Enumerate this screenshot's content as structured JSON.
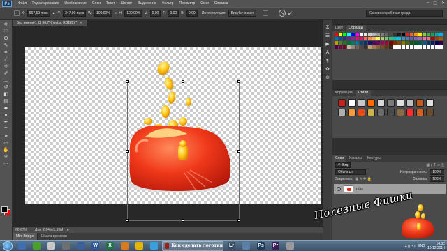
{
  "app": {
    "logo": "Ps"
  },
  "menu": [
    "Файл",
    "Редактирование",
    "Изображение",
    "Слои",
    "Текст",
    "Шрифт",
    "Выделение",
    "Фильтр",
    "Просмотр",
    "Окно",
    "Справка"
  ],
  "options": {
    "x_label": "X:",
    "x_value": "667,50 пикс",
    "y_label": "Y:",
    "y_value": "347,00 пикс",
    "w_label": "W:",
    "w_value": "100,00%",
    "h_label": "H:",
    "h_value": "100,00%",
    "angle_value": "0,00",
    "hskew_label": "Г:",
    "hskew_value": "0,00",
    "vskew_label": "В:",
    "vskew_value": "0,00",
    "interp_label": "Интерполяция:",
    "interp_value": "Бикубическая",
    "workspace": "Основная рабочая среда"
  },
  "document": {
    "tab_title": "Без имени-1 @ 66,7% (rebs, RGB/8) *",
    "zoom": "66,67%",
    "doc_info": "Док: 2,64М/1,99М"
  },
  "bottom_tabs": [
    "Mini Bridge",
    "Шкала времени"
  ],
  "panels": {
    "swatches_tabs": [
      "Цвет",
      "Образцы"
    ],
    "styles_tabs": [
      "Коррекция",
      "Стили"
    ],
    "layers_tabs": [
      "Слои",
      "Каналы",
      "Контуры"
    ],
    "kind_label": "Вид",
    "blend_mode": "Обычные",
    "opacity_label": "Непрозрачность:",
    "opacity_value": "100%",
    "lock_label": "Закрепить:",
    "fill_label": "Заливка:",
    "fill_value": "100%",
    "layer_name": "rebs"
  },
  "swatch_colors": [
    "#ff0000",
    "#ffff00",
    "#00ff00",
    "#00ffff",
    "#0000ff",
    "#ff00ff",
    "#ffffff",
    "#e6e6e6",
    "#cccccc",
    "#b3b3b3",
    "#999999",
    "#808080",
    "#666666",
    "#4d4d4d",
    "#333333",
    "#1a1a1a",
    "#000000",
    "#ed1c24",
    "#f26522",
    "#f7941d",
    "#fff200",
    "#8dc63f",
    "#39b54a",
    "#00a651",
    "#00a99d",
    "#00aeef",
    "#0072bc",
    "#0054a6",
    "#2e3192",
    "#662d91",
    "#92278f",
    "#ec008c",
    "#ed145b",
    "#f26c4f",
    "#f68e56",
    "#fbaf5d",
    "#fff568",
    "#acd373",
    "#7cc576",
    "#3cb878",
    "#1cbbb4",
    "#00bff3",
    "#448ccb",
    "#5674b9",
    "#605ca8",
    "#8560a8",
    "#a864a8",
    "#f06eaa",
    "#f26d7d",
    "#9e0b0f",
    "#a0410d",
    "#a36209",
    "#aba000",
    "#598527",
    "#1a7b30",
    "#007236",
    "#00746b",
    "#0076a3",
    "#004b80",
    "#003471",
    "#1b1464",
    "#440e62",
    "#630460",
    "#9e005d",
    "#9e0039",
    "#790000",
    "#7b2e00",
    "#7d4900",
    "#827b00",
    "#406618",
    "#005e20",
    "#005826",
    "#005952",
    "#005b7f",
    "#003663",
    "#002157",
    "#0d004c",
    "#32004b",
    "#4b0049",
    "#7b0046",
    "#7a0026",
    "#c7b299",
    "#998675",
    "#736357",
    "#534741",
    "#37302d",
    "#c69c6d",
    "#a67c52",
    "#8c6239",
    "#754c24",
    "#603913",
    "#3c2415",
    "#ffffff",
    "#ffffff",
    "#ffffff",
    "#ffffff",
    "#ffffff",
    "#ffffff",
    "#ffffff",
    "#ffffff",
    "#ffffff",
    "#ffffff",
    "#ffffff",
    "#ffffff"
  ],
  "style_colors": [
    "#cc2020",
    "#ffffff",
    "#c9c9c9",
    "#ff6a00",
    "#d8d8d8",
    "#7a7a7a",
    "#e0e0e0",
    "#c0c0c0",
    "#c45a1a",
    "#e0e0e0",
    "#b0b0b0",
    "#ff9a3a",
    "#e84a1a",
    "#d2b04a",
    "#6a6a6a",
    "#4a4a4a",
    "#8a6a40",
    "#ff2a2a",
    "#d06020",
    "#6a4a2a"
  ],
  "watermark_text": "Полезные Фишки",
  "taskbar": {
    "apps": [
      {
        "letter": "",
        "color": "#3f6fb0"
      },
      {
        "letter": "",
        "color": "#4aa02c"
      },
      {
        "letter": "",
        "color": "#c8c8c8"
      },
      {
        "letter": "",
        "color": "#6e6e6e"
      },
      {
        "letter": "",
        "color": "#3d5f9a"
      },
      {
        "letter": "W",
        "color": "#2b579a"
      },
      {
        "letter": "X",
        "color": "#217346"
      },
      {
        "letter": "",
        "color": "#d87b1c"
      },
      {
        "letter": "",
        "color": "#e8b400"
      },
      {
        "letter": "",
        "color": "#3aa0dd"
      }
    ],
    "active_app_title": "Как сделать логотип",
    "right_apps": [
      {
        "letter": "Lr",
        "color": "#3a4f66"
      },
      {
        "letter": "",
        "color": "#5a7fa8"
      },
      {
        "letter": "Ps",
        "color": "#1e3a5a"
      },
      {
        "letter": "Pr",
        "color": "#3a1f5a"
      },
      {
        "letter": "",
        "color": "#9a9a9a"
      }
    ],
    "lang": "ENG",
    "time": "14:32",
    "date": "10.12.2014"
  }
}
